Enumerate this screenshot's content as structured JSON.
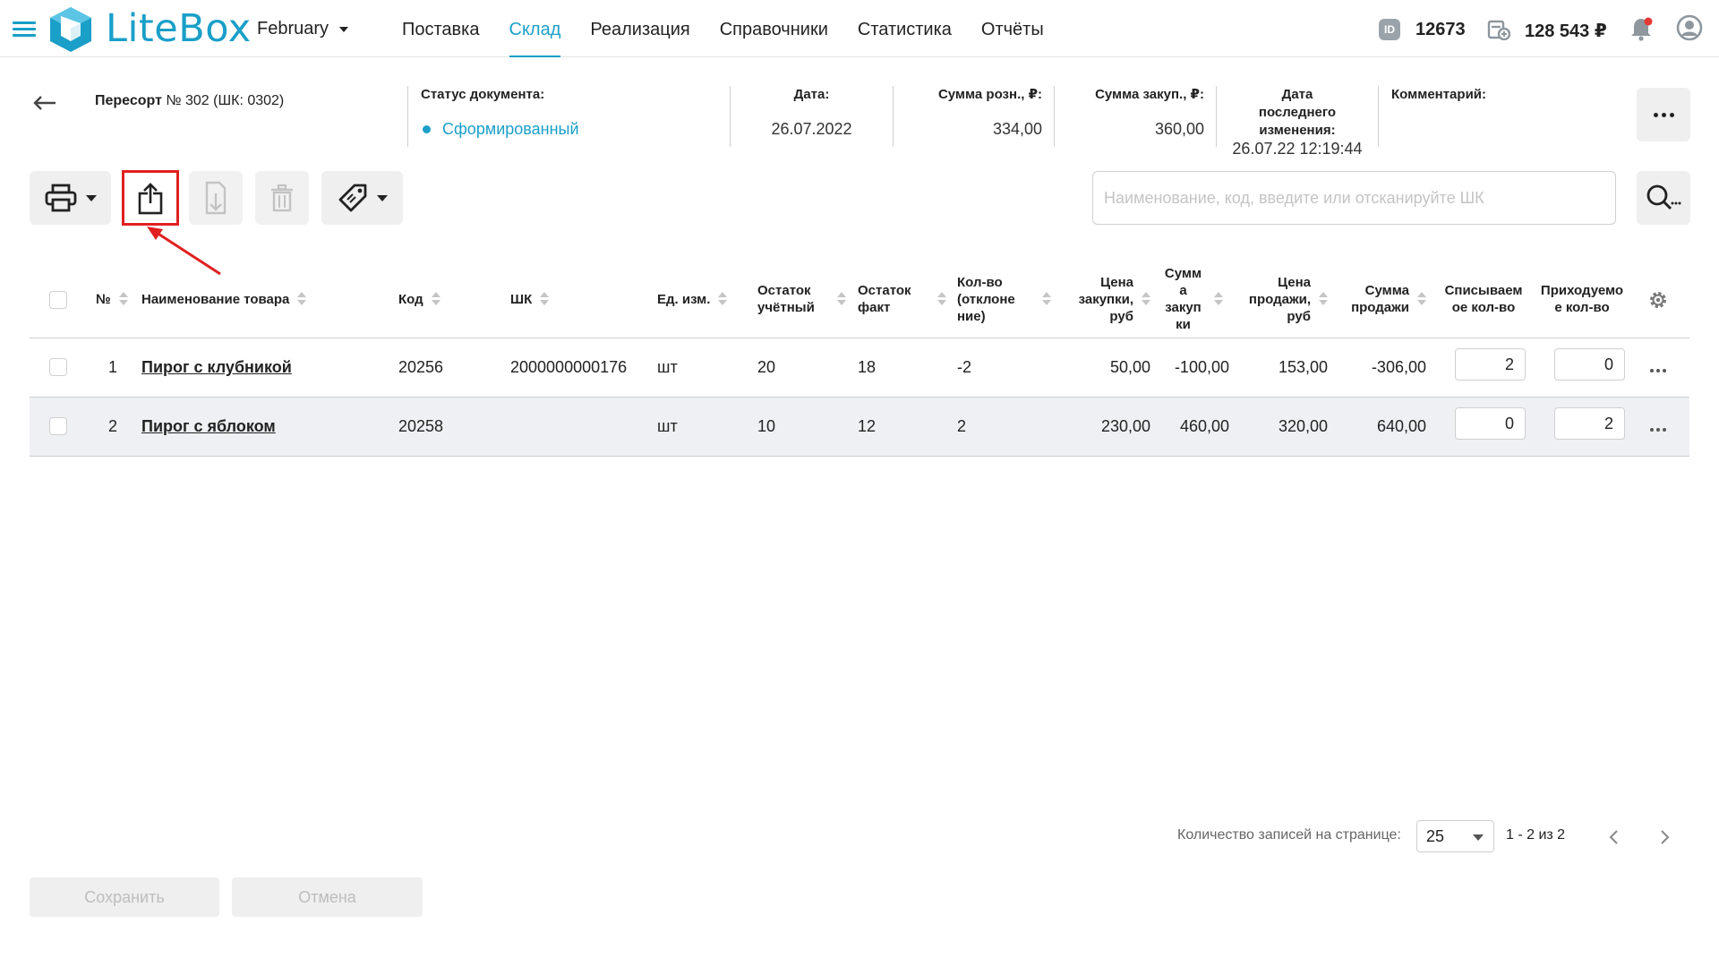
{
  "header": {
    "logo_text": "LiteBox",
    "month": "February",
    "nav": [
      "Поставка",
      "Склад",
      "Реализация",
      "Справочники",
      "Статистика",
      "Отчёты"
    ],
    "active_nav": "Склад",
    "id_icon_text": "ID",
    "id_value": "12673",
    "balance": "128 543 ₽",
    "accent_color": "#1a9fc8"
  },
  "document": {
    "title_bold": "Пересорт",
    "title_rest": " № 302 (ШК: 0302)",
    "status_label": "Статус документа:",
    "status_value": "Сформированный",
    "date_label": "Дата:",
    "date_value": "26.07.2022",
    "retail_sum_label": "Сумма розн., ₽:",
    "retail_sum_value": "334,00",
    "purchase_sum_label": "Сумма закуп., ₽:",
    "purchase_sum_value": "360,00",
    "last_change_label": "Дата последнего изменения:",
    "last_change_value": "26.07.22 12:19:44",
    "comment_label": "Комментарий:",
    "comment_value": ""
  },
  "toolbar": {
    "search_placeholder": "Наименование, код, введите или отсканируйте ШК"
  },
  "table": {
    "columns": {
      "num": "№",
      "name": "Наименование товара",
      "code": "Код",
      "barcode": "ШК",
      "unit": "Ед. изм.",
      "stock_book": "Остаток учётный",
      "stock_fact": "Остаток факт",
      "qty_dev": "Кол-во (отклоне ние)",
      "price_purchase": "Цена закупки, руб",
      "sum_purchase": "Сумм а закуп ки",
      "price_sale": "Цена продажи, руб",
      "sum_sale": "Сумма продажи",
      "write_off": "Списываем ое кол-во",
      "incoming": "Приходуемо е кол-во"
    },
    "rows": [
      {
        "num": "1",
        "name": "Пирог с клубникой",
        "code": "20256",
        "barcode": "2000000000176",
        "unit": "шт",
        "stock_book": "20",
        "stock_fact": "18",
        "qty_dev": "-2",
        "price_purchase": "50,00",
        "sum_purchase": "-100,00",
        "price_sale": "153,00",
        "sum_sale": "-306,00",
        "write_off": "2",
        "incoming": "0"
      },
      {
        "num": "2",
        "name": "Пирог с яблоком",
        "code": "20258",
        "barcode": "",
        "unit": "шт",
        "stock_book": "10",
        "stock_fact": "12",
        "qty_dev": "2",
        "price_purchase": "230,00",
        "sum_purchase": "460,00",
        "price_sale": "320,00",
        "sum_sale": "640,00",
        "write_off": "0",
        "incoming": "2"
      }
    ]
  },
  "pagination": {
    "label": "Количество записей на странице:",
    "page_size": "25",
    "range": "1 - 2 из 2"
  },
  "footer": {
    "save": "Сохранить",
    "cancel": "Отмена"
  },
  "annotation": {
    "highlight_color": "#e02020"
  }
}
